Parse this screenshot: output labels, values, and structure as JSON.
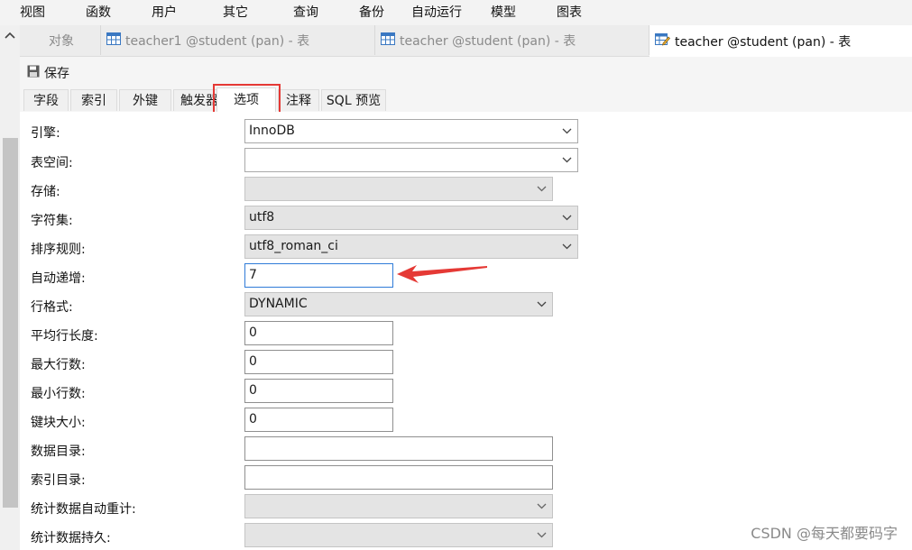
{
  "menu": [
    "视图",
    "函数",
    "用户",
    "其它",
    "查询",
    "备份",
    "自动运行",
    "模型",
    "图表"
  ],
  "doc_tabs": [
    {
      "label": "对象",
      "icon": "none",
      "active": false
    },
    {
      "label": "teacher1 @student (pan) - 表",
      "icon": "table-icon",
      "active": false
    },
    {
      "label": "teacher @student (pan) - 表",
      "icon": "table-icon",
      "active": false
    },
    {
      "label": "teacher @student (pan) - 表",
      "icon": "table-edit-icon",
      "active": true
    }
  ],
  "toolbar": {
    "save_label": "保存",
    "save_icon": "save-icon"
  },
  "sub_tabs": [
    {
      "label": "字段"
    },
    {
      "label": "索引"
    },
    {
      "label": "外键"
    },
    {
      "label": "触发器"
    },
    {
      "label": "选项",
      "active": true
    },
    {
      "label": "注释"
    },
    {
      "label": "SQL 预览"
    }
  ],
  "options": [
    {
      "label": "引擎:",
      "value": "InnoDB",
      "kind": "select"
    },
    {
      "label": "表空间:",
      "value": "",
      "kind": "select"
    },
    {
      "label": "存储:",
      "value": "",
      "kind": "select-disabled"
    },
    {
      "label": "字符集:",
      "value": "utf8",
      "kind": "select-gray"
    },
    {
      "label": "排序规则:",
      "value": "utf8_roman_ci",
      "kind": "select-gray"
    },
    {
      "label": "自动递增:",
      "value": "7",
      "kind": "input-focused"
    },
    {
      "label": "行格式:",
      "value": "DYNAMIC",
      "kind": "select-gray"
    },
    {
      "label": "平均行长度:",
      "value": "0",
      "kind": "input"
    },
    {
      "label": "最大行数:",
      "value": "0",
      "kind": "input"
    },
    {
      "label": "最小行数:",
      "value": "0",
      "kind": "input"
    },
    {
      "label": "键块大小:",
      "value": "0",
      "kind": "input"
    },
    {
      "label": "数据目录:",
      "value": "",
      "kind": "input"
    },
    {
      "label": "索引目录:",
      "value": "",
      "kind": "input"
    },
    {
      "label": "统计数据自动重计:",
      "value": "",
      "kind": "select-disabled"
    },
    {
      "label": "统计数据持久:",
      "value": "",
      "kind": "select-disabled"
    }
  ],
  "watermark": "CSDN @每天都要码字",
  "colors": {
    "highlight": "#e53935",
    "focus": "#2f7bd8",
    "arrow": "#e53935"
  }
}
